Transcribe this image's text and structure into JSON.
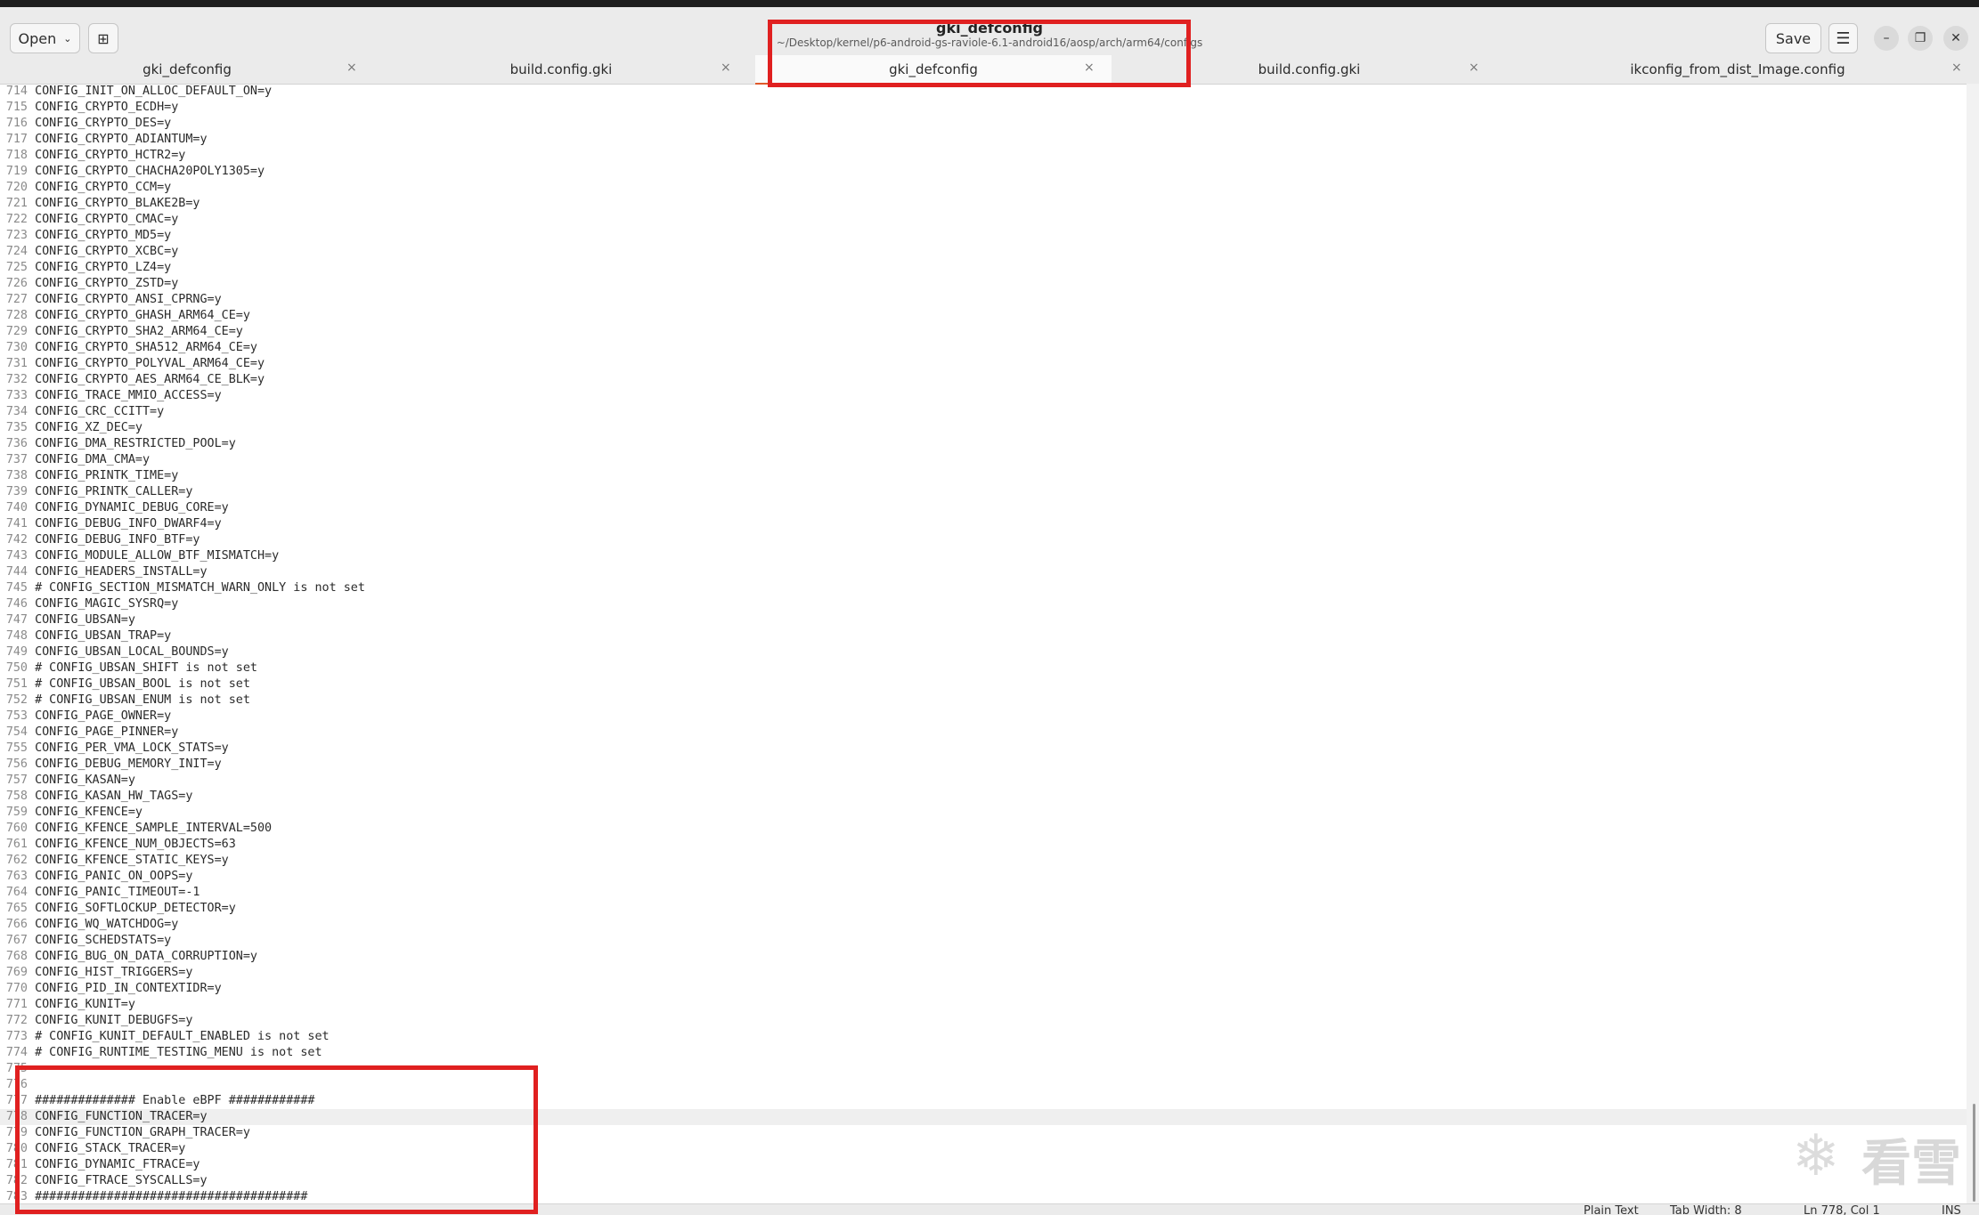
{
  "window": {
    "title": "gki_defconfig",
    "subtitle": "~/Desktop/kernel/p6-android-gs-raviole-6.1-android16/aosp/arch/arm64/configs"
  },
  "toolbar": {
    "open_label": "Open",
    "save_label": "Save"
  },
  "tabs": [
    {
      "label": "gki_defconfig",
      "active": false
    },
    {
      "label": "build.config.gki",
      "active": false
    },
    {
      "label": "gki_defconfig",
      "active": true
    },
    {
      "label": "build.config.gki",
      "active": false
    },
    {
      "label": "ikconfig_from_dist_Image.config",
      "active": false
    }
  ],
  "editor": {
    "current_line": 778,
    "lines": [
      {
        "n": 714,
        "t": "CONFIG_INIT_ON_ALLOC_DEFAULT_ON=y"
      },
      {
        "n": 715,
        "t": "CONFIG_CRYPTO_ECDH=y"
      },
      {
        "n": 716,
        "t": "CONFIG_CRYPTO_DES=y"
      },
      {
        "n": 717,
        "t": "CONFIG_CRYPTO_ADIANTUM=y"
      },
      {
        "n": 718,
        "t": "CONFIG_CRYPTO_HCTR2=y"
      },
      {
        "n": 719,
        "t": "CONFIG_CRYPTO_CHACHA20POLY1305=y"
      },
      {
        "n": 720,
        "t": "CONFIG_CRYPTO_CCM=y"
      },
      {
        "n": 721,
        "t": "CONFIG_CRYPTO_BLAKE2B=y"
      },
      {
        "n": 722,
        "t": "CONFIG_CRYPTO_CMAC=y"
      },
      {
        "n": 723,
        "t": "CONFIG_CRYPTO_MD5=y"
      },
      {
        "n": 724,
        "t": "CONFIG_CRYPTO_XCBC=y"
      },
      {
        "n": 725,
        "t": "CONFIG_CRYPTO_LZ4=y"
      },
      {
        "n": 726,
        "t": "CONFIG_CRYPTO_ZSTD=y"
      },
      {
        "n": 727,
        "t": "CONFIG_CRYPTO_ANSI_CPRNG=y"
      },
      {
        "n": 728,
        "t": "CONFIG_CRYPTO_GHASH_ARM64_CE=y"
      },
      {
        "n": 729,
        "t": "CONFIG_CRYPTO_SHA2_ARM64_CE=y"
      },
      {
        "n": 730,
        "t": "CONFIG_CRYPTO_SHA512_ARM64_CE=y"
      },
      {
        "n": 731,
        "t": "CONFIG_CRYPTO_POLYVAL_ARM64_CE=y"
      },
      {
        "n": 732,
        "t": "CONFIG_CRYPTO_AES_ARM64_CE_BLK=y"
      },
      {
        "n": 733,
        "t": "CONFIG_TRACE_MMIO_ACCESS=y"
      },
      {
        "n": 734,
        "t": "CONFIG_CRC_CCITT=y"
      },
      {
        "n": 735,
        "t": "CONFIG_XZ_DEC=y"
      },
      {
        "n": 736,
        "t": "CONFIG_DMA_RESTRICTED_POOL=y"
      },
      {
        "n": 737,
        "t": "CONFIG_DMA_CMA=y"
      },
      {
        "n": 738,
        "t": "CONFIG_PRINTK_TIME=y"
      },
      {
        "n": 739,
        "t": "CONFIG_PRINTK_CALLER=y"
      },
      {
        "n": 740,
        "t": "CONFIG_DYNAMIC_DEBUG_CORE=y"
      },
      {
        "n": 741,
        "t": "CONFIG_DEBUG_INFO_DWARF4=y"
      },
      {
        "n": 742,
        "t": "CONFIG_DEBUG_INFO_BTF=y"
      },
      {
        "n": 743,
        "t": "CONFIG_MODULE_ALLOW_BTF_MISMATCH=y"
      },
      {
        "n": 744,
        "t": "CONFIG_HEADERS_INSTALL=y"
      },
      {
        "n": 745,
        "t": "# CONFIG_SECTION_MISMATCH_WARN_ONLY is not set"
      },
      {
        "n": 746,
        "t": "CONFIG_MAGIC_SYSRQ=y"
      },
      {
        "n": 747,
        "t": "CONFIG_UBSAN=y"
      },
      {
        "n": 748,
        "t": "CONFIG_UBSAN_TRAP=y"
      },
      {
        "n": 749,
        "t": "CONFIG_UBSAN_LOCAL_BOUNDS=y"
      },
      {
        "n": 750,
        "t": "# CONFIG_UBSAN_SHIFT is not set"
      },
      {
        "n": 751,
        "t": "# CONFIG_UBSAN_BOOL is not set"
      },
      {
        "n": 752,
        "t": "# CONFIG_UBSAN_ENUM is not set"
      },
      {
        "n": 753,
        "t": "CONFIG_PAGE_OWNER=y"
      },
      {
        "n": 754,
        "t": "CONFIG_PAGE_PINNER=y"
      },
      {
        "n": 755,
        "t": "CONFIG_PER_VMA_LOCK_STATS=y"
      },
      {
        "n": 756,
        "t": "CONFIG_DEBUG_MEMORY_INIT=y"
      },
      {
        "n": 757,
        "t": "CONFIG_KASAN=y"
      },
      {
        "n": 758,
        "t": "CONFIG_KASAN_HW_TAGS=y"
      },
      {
        "n": 759,
        "t": "CONFIG_KFENCE=y"
      },
      {
        "n": 760,
        "t": "CONFIG_KFENCE_SAMPLE_INTERVAL=500"
      },
      {
        "n": 761,
        "t": "CONFIG_KFENCE_NUM_OBJECTS=63"
      },
      {
        "n": 762,
        "t": "CONFIG_KFENCE_STATIC_KEYS=y"
      },
      {
        "n": 763,
        "t": "CONFIG_PANIC_ON_OOPS=y"
      },
      {
        "n": 764,
        "t": "CONFIG_PANIC_TIMEOUT=-1"
      },
      {
        "n": 765,
        "t": "CONFIG_SOFTLOCKUP_DETECTOR=y"
      },
      {
        "n": 766,
        "t": "CONFIG_WQ_WATCHDOG=y"
      },
      {
        "n": 767,
        "t": "CONFIG_SCHEDSTATS=y"
      },
      {
        "n": 768,
        "t": "CONFIG_BUG_ON_DATA_CORRUPTION=y"
      },
      {
        "n": 769,
        "t": "CONFIG_HIST_TRIGGERS=y"
      },
      {
        "n": 770,
        "t": "CONFIG_PID_IN_CONTEXTIDR=y"
      },
      {
        "n": 771,
        "t": "CONFIG_KUNIT=y"
      },
      {
        "n": 772,
        "t": "CONFIG_KUNIT_DEBUGFS=y"
      },
      {
        "n": 773,
        "t": "# CONFIG_KUNIT_DEFAULT_ENABLED is not set"
      },
      {
        "n": 774,
        "t": "# CONFIG_RUNTIME_TESTING_MENU is not set"
      },
      {
        "n": 775,
        "t": ""
      },
      {
        "n": 776,
        "t": ""
      },
      {
        "n": 777,
        "t": "############## Enable eBPF ############"
      },
      {
        "n": 778,
        "t": "CONFIG_FUNCTION_TRACER=y"
      },
      {
        "n": 779,
        "t": "CONFIG_FUNCTION_GRAPH_TRACER=y"
      },
      {
        "n": 780,
        "t": "CONFIG_STACK_TRACER=y"
      },
      {
        "n": 781,
        "t": "CONFIG_DYNAMIC_FTRACE=y"
      },
      {
        "n": 782,
        "t": "CONFIG_FTRACE_SYSCALLS=y"
      },
      {
        "n": 783,
        "t": "######################################"
      }
    ]
  },
  "statusbar": {
    "language": "Plain Text",
    "tab_width": "Tab Width: 8",
    "position": "Ln 778, Col 1",
    "mode": "INS"
  },
  "watermark": {
    "text": "看雪",
    "icon": "snowflake-icon"
  },
  "colors": {
    "highlight_box": "#e02020",
    "active_tab_underline": "#e0592a"
  }
}
